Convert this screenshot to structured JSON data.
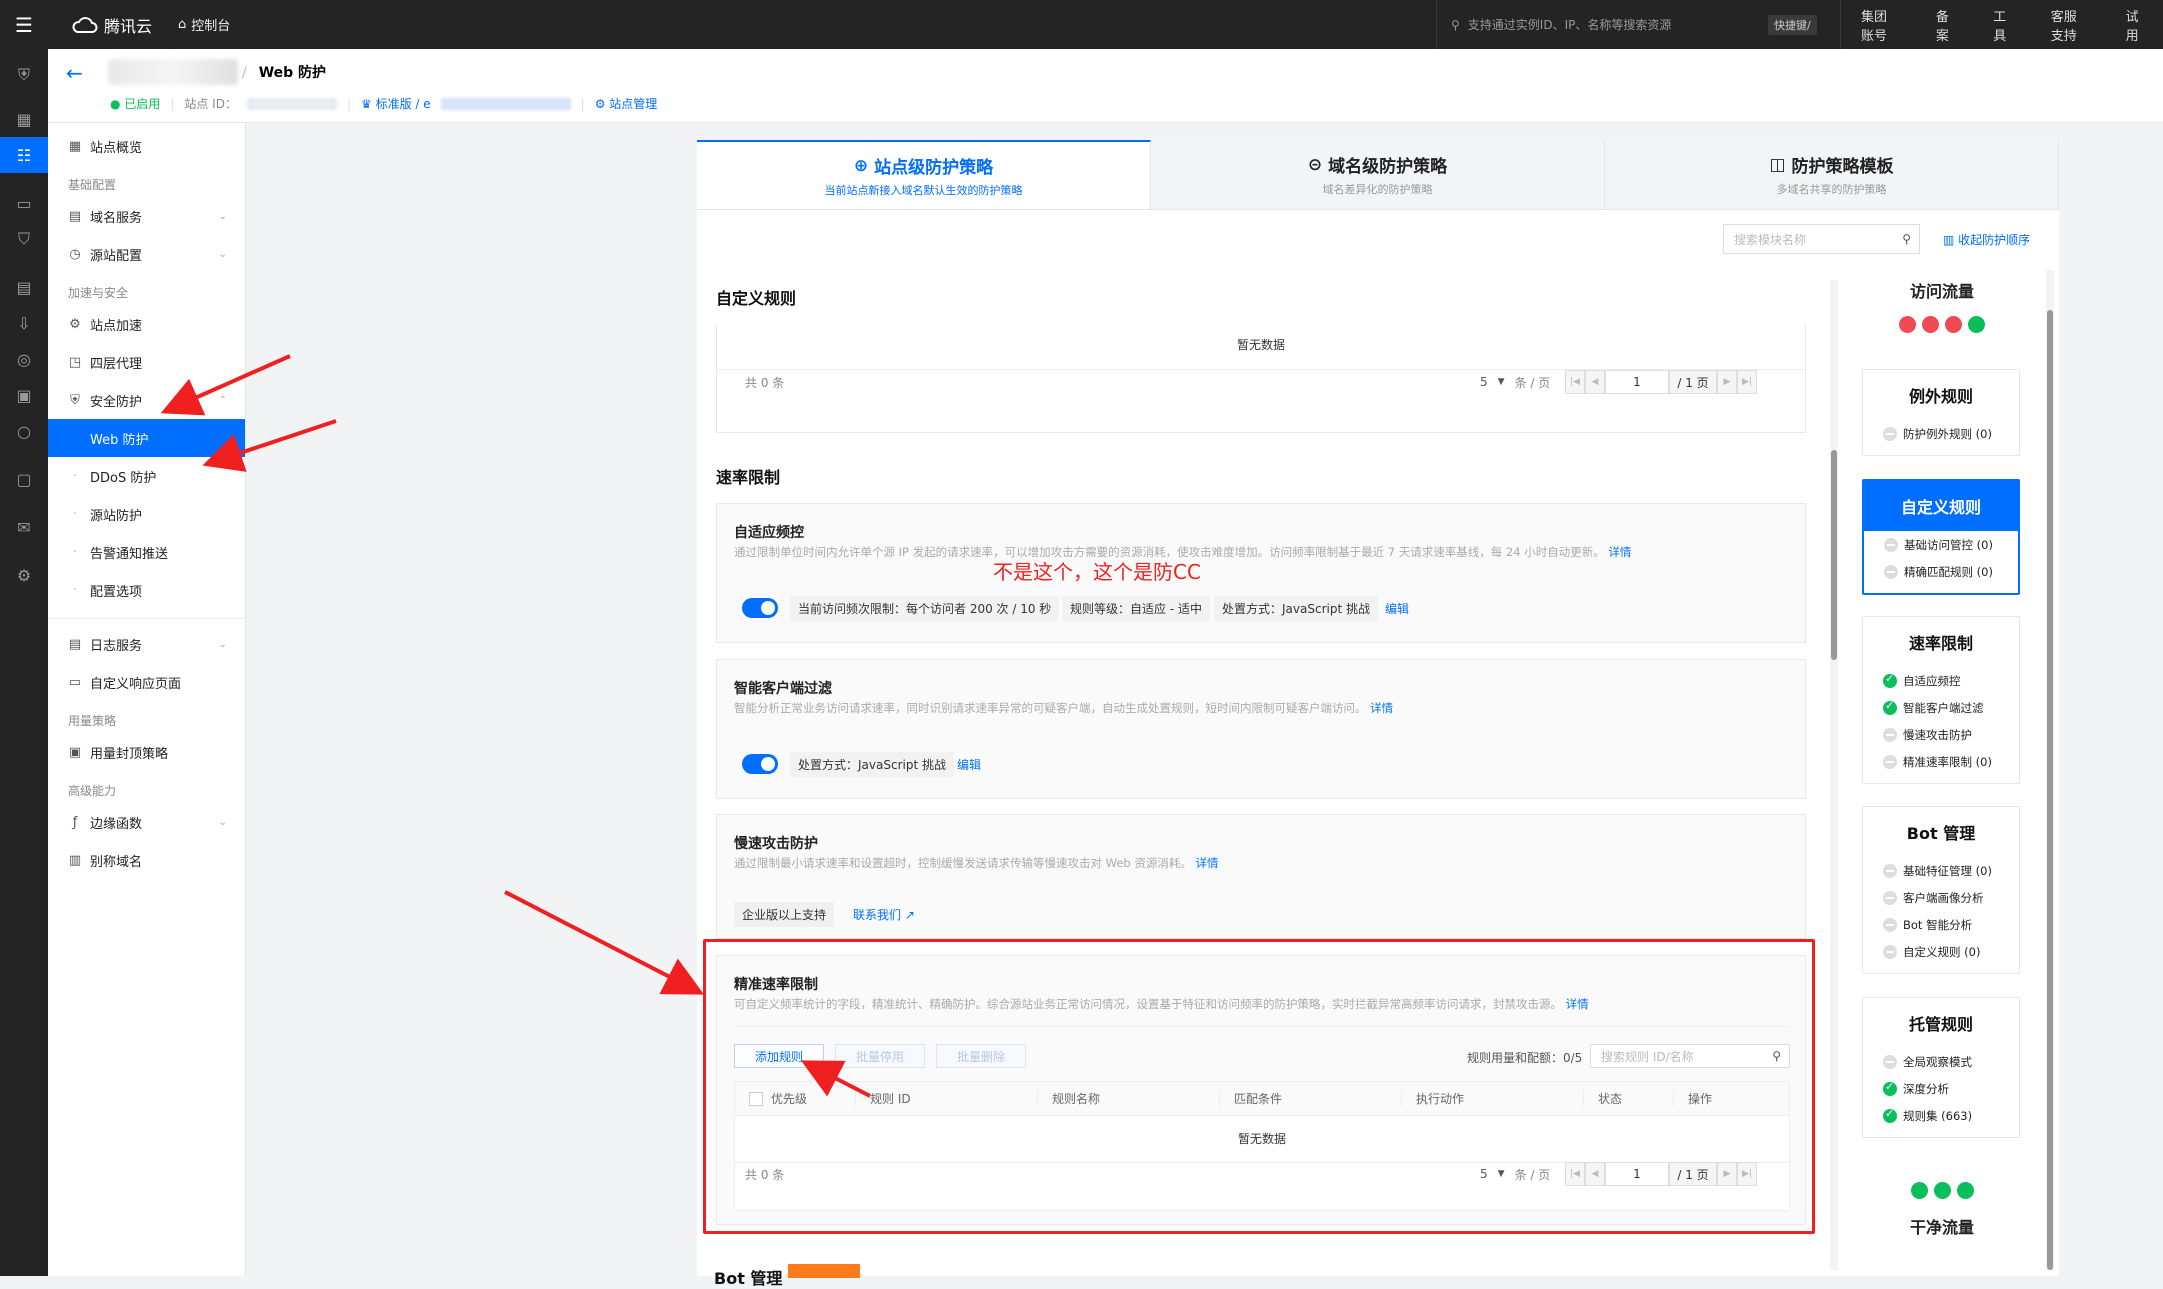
{
  "topbar": {
    "brand": "腾讯云",
    "console": "控制台",
    "search_placeholder": "支持通过实例ID、IP、名称等搜索资源",
    "shortcut": "快捷键/",
    "nav": [
      "集团账号",
      "备案",
      "工具",
      "客服支持",
      "试用"
    ]
  },
  "header": {
    "breadcrumb_sep": "/",
    "page_title": "Web 防护",
    "status": "已启用",
    "site_id_label": "站点 ID：",
    "plan": "标准版 / e",
    "site_manage": "站点管理"
  },
  "sidebar": {
    "overview": "站点概览",
    "group_basic": "基础配置",
    "domain_service": "域名服务",
    "origin_config": "源站配置",
    "group_accel": "加速与安全",
    "site_accel": "站点加速",
    "l4_proxy": "四层代理",
    "security": "安全防护",
    "web_protect": "Web 防护",
    "ddos": "DDoS 防护",
    "origin_protect": "源站防护",
    "alert_push": "告警通知推送",
    "config_options": "配置选项",
    "log_service": "日志服务",
    "custom_error_page": "自定义响应页面",
    "group_usage": "用量策略",
    "usage_cap": "用量封顶策略",
    "group_advanced": "高级能力",
    "edge_functions": "边缘函数",
    "alias_domain": "别称域名"
  },
  "tabs": [
    {
      "title": "站点级防护策略",
      "subtitle": "当前站点新接入域名默认生效的防护策略"
    },
    {
      "title": "域名级防护策略",
      "subtitle": "域名差异化的防护策略"
    },
    {
      "title": "防护策略模板",
      "subtitle": "多域名共享的防护策略"
    }
  ],
  "module_search_placeholder": "搜索模块名称",
  "collapse_label": "收起防护顺序",
  "custom_rules": {
    "title": "自定义规则",
    "empty": "暂无数据",
    "total": "共  0  条",
    "page_size": "5",
    "per_page": "条 / 页",
    "page": "1",
    "pages": "/ 1 页"
  },
  "rate_limit": {
    "title": "速率限制",
    "adaptive": {
      "title": "自适应频控",
      "desc": "通过限制单位时间内允许单个源 IP 发起的请求速率，可以增加攻击方需要的资源消耗，使攻击难度增加。访问频率限制基于最近 7 天请求速率基线，每 24 小时自动更新。",
      "detail": "详情",
      "tag1": "当前访问频次限制：每个访问者 200 次 / 10 秒",
      "tag2": "规则等级：自适应 - 适中",
      "tag3": "处置方式：JavaScript 挑战",
      "edit": "编辑"
    },
    "smart_client": {
      "title": "智能客户端过滤",
      "desc": "智能分析正常业务访问请求速率，同时识别请求速率异常的可疑客户端，自动生成处置规则，短时间内限制可疑客户端访问。",
      "detail": "详情",
      "tag1": "处置方式：JavaScript 挑战",
      "edit": "编辑"
    },
    "slow_attack": {
      "title": "慢速攻击防护",
      "desc": "通过限制最小请求速率和设置超时，控制缓慢发送请求传输等慢速攻击对 Web 资源消耗。",
      "detail": "详情",
      "tag1": "企业版以上支持",
      "contact": "联系我们"
    },
    "precise": {
      "title": "精准速率限制",
      "desc": "可自定义频率统计的字段，精准统计、精确防护。综合源站业务正常访问情况，设置基于特征和访问频率的防护策略，实时拦截异常高频率访问请求，封禁攻击源。",
      "detail": "详情",
      "add_rule": "添加规则",
      "batch_disable": "批量停用",
      "batch_delete": "批量删除",
      "quota": "规则用量和配额：0/5",
      "search_placeholder": "搜索规则 ID/名称",
      "columns": [
        "优先级",
        "规则 ID",
        "规则名称",
        "匹配条件",
        "执行动作",
        "状态",
        "操作"
      ],
      "empty": "暂无数据",
      "total": "共  0  条",
      "page_size": "5",
      "per_page": "条 / 页",
      "page": "1",
      "pages": "/ 1 页"
    }
  },
  "annotation": "不是这个，这个是防CC",
  "bot_title": "Bot 管理",
  "right_panel": {
    "top": "访问流量",
    "bottom": "干净流量",
    "cards": [
      {
        "title": "例外规则",
        "items": [
          {
            "label": "防护例外规则 (0)",
            "state": "off"
          }
        ]
      },
      {
        "title": "自定义规则",
        "items": [
          {
            "label": "基础访问管控 (0)",
            "state": "off"
          },
          {
            "label": "精确匹配规则 (0)",
            "state": "off"
          }
        ]
      },
      {
        "title": "速率限制",
        "items": [
          {
            "label": "自适应频控",
            "state": "on"
          },
          {
            "label": "智能客户端过滤",
            "state": "on"
          },
          {
            "label": "慢速攻击防护",
            "state": "off"
          },
          {
            "label": "精准速率限制 (0)",
            "state": "off"
          }
        ]
      },
      {
        "title": "Bot 管理",
        "items": [
          {
            "label": "基础特征管理 (0)",
            "state": "off"
          },
          {
            "label": "客户端画像分析",
            "state": "off"
          },
          {
            "label": "Bot 智能分析",
            "state": "off"
          },
          {
            "label": "自定义规则 (0)",
            "state": "off"
          }
        ]
      },
      {
        "title": "托管规则",
        "items": [
          {
            "label": "全局观察模式",
            "state": "off"
          },
          {
            "label": "深度分析",
            "state": "on"
          },
          {
            "label": "规则集 (663)",
            "state": "on"
          }
        ]
      }
    ]
  },
  "colors": {
    "accent": "#006eff",
    "annotation": "#f02020",
    "success": "#0abf5b"
  }
}
